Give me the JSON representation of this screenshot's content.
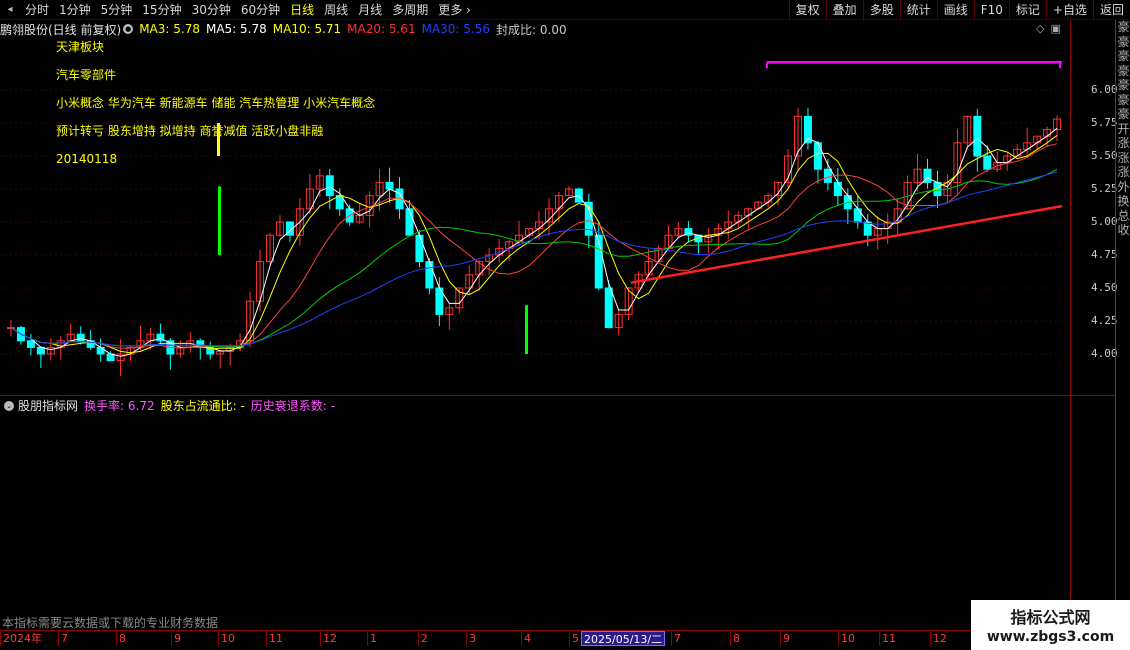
{
  "toolbar": {
    "periods": [
      "分时",
      "1分钟",
      "5分钟",
      "15分钟",
      "30分钟",
      "60分钟",
      "日线",
      "周线",
      "月线",
      "多周期",
      "更多"
    ],
    "active_period": "日线",
    "right_buttons": [
      "复权",
      "叠加",
      "多股",
      "统计",
      "画线",
      "F10",
      "标记",
      "+自选",
      "返回"
    ]
  },
  "info": {
    "stock_title": "鹏翎股份(日线 前复权)",
    "ma3": "MA3: 5.78",
    "ma5": "MA5: 5.78",
    "ma10": "MA10: 5.71",
    "ma20": "MA20: 5.61",
    "ma30": "MA30: 5.56",
    "seal_ratio": "封成比: 0.00"
  },
  "colors": {
    "ma3": "#ffffff",
    "ma5": "#ffff00",
    "ma10": "#ff4040",
    "ma20": "#00cc00",
    "ma30": "#2040ff",
    "up": "#ff3030",
    "down": "#00ffff",
    "ma5_label": "#ffff00",
    "ma10_label": "#ffff00",
    "ma20_label": "#ff3030",
    "ma30_label": "#0000ff"
  },
  "concepts": [
    "天津板块",
    "汽车零部件",
    "小米概念 华为汽车 新能源车 储能 汽车热管理 小米汽车概念",
    "预计转亏 股东增持 拟增持 商誉减值 活跃小盘非融",
    "20140118"
  ],
  "y_axis_ticks": [
    "6.00",
    "5.75",
    "5.50",
    "5.25",
    "5.00",
    "4.75",
    "4.50",
    "4.25",
    "4.00"
  ],
  "right_panel_glyphs": [
    "豪",
    "豪",
    "豪",
    "豪",
    "豪",
    "豪",
    "豪",
    "开",
    "涨",
    "涨",
    "涨",
    "外",
    "换",
    "总",
    "收",
    "",
    "",
    "",
    "",
    "",
    "",
    "",
    "",
    "",
    "",
    "",
    "",
    "",
    "",
    "",
    "",
    "",
    "",
    "",
    "",
    "",
    "",
    "",
    "",
    "",
    ""
  ],
  "indicator": {
    "name": "股朋指标网",
    "turnover": "换手率: 6.72",
    "holder_ratio": "股东占流通比: -",
    "history": "历史衰退系数: -"
  },
  "notice": "本指标需要云数据或下载的专业财务数据",
  "date_axis": {
    "labels": [
      "2024年",
      "7",
      "8",
      "9",
      "10",
      "11",
      "12",
      "1",
      "2",
      "3",
      "4",
      "5",
      "7",
      "8",
      "9",
      "10",
      "11",
      "12"
    ],
    "cursor": "2025/05/13/二"
  },
  "watermark": {
    "title": "指标公式网",
    "url": "www.zbgs3.com"
  },
  "chart_data": {
    "type": "candlestick",
    "ylim": [
      3.75,
      6.25
    ],
    "y_ticks": [
      4.0,
      4.25,
      4.5,
      4.75,
      5.0,
      5.25,
      5.5,
      5.75,
      6.0
    ],
    "series": [
      {
        "name": "MA3",
        "values": []
      },
      {
        "name": "MA5",
        "values": []
      },
      {
        "name": "MA10",
        "values": []
      },
      {
        "name": "MA20",
        "values": []
      },
      {
        "name": "MA30",
        "values": []
      }
    ],
    "close_approx": [
      4.2,
      4.1,
      4.05,
      4.0,
      4.05,
      4.1,
      4.15,
      4.1,
      4.05,
      4.0,
      3.95,
      4.0,
      4.05,
      4.1,
      4.15,
      4.1,
      4.0,
      4.05,
      4.1,
      4.05,
      4.0,
      4.02,
      4.05,
      4.1,
      4.4,
      4.7,
      4.9,
      5.0,
      4.9,
      5.1,
      5.25,
      5.35,
      5.2,
      5.1,
      5.0,
      5.05,
      5.2,
      5.3,
      5.25,
      5.1,
      4.9,
      4.7,
      4.5,
      4.3,
      4.35,
      4.5,
      4.6,
      4.7,
      4.75,
      4.8,
      4.85,
      4.9,
      4.95,
      5.0,
      5.1,
      5.2,
      5.25,
      5.15,
      4.9,
      4.5,
      4.2,
      4.3,
      4.5,
      4.6,
      4.7,
      4.8,
      4.9,
      4.95,
      4.9,
      4.85,
      4.9,
      4.95,
      5.0,
      5.05,
      5.1,
      5.15,
      5.2,
      5.3,
      5.5,
      5.8,
      5.6,
      5.4,
      5.3,
      5.2,
      5.1,
      5.0,
      4.9,
      4.95,
      5.0,
      5.1,
      5.3,
      5.4,
      5.3,
      5.2,
      5.3,
      5.6,
      5.8,
      5.5,
      5.4,
      5.45,
      5.5,
      5.55,
      5.6,
      5.65,
      5.7,
      5.78
    ],
    "reference_lines": [
      {
        "color": "magenta",
        "from_value": 6.21,
        "to_value": 6.21
      },
      {
        "color": "red",
        "from_value": 4.54,
        "to_value": 5.12
      }
    ]
  }
}
